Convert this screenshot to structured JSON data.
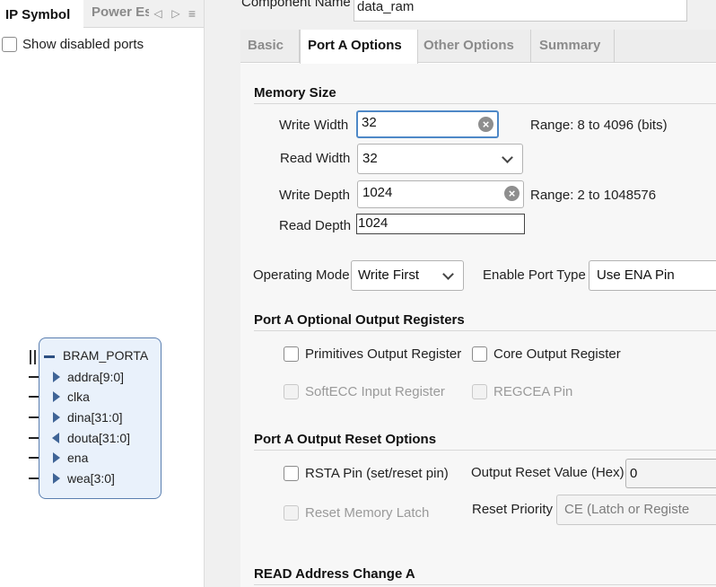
{
  "left_panel": {
    "tabs": {
      "ip_symbol": "IP Symbol",
      "power": "Power Es"
    },
    "nav": {
      "prev": "◁",
      "next": "▷",
      "menu": "≡"
    },
    "show_disabled_ports": "Show disabled ports",
    "block": {
      "bus": "BRAM_PORTA",
      "pins": [
        {
          "name": "addra[9:0]",
          "dir": "in"
        },
        {
          "name": "clka",
          "dir": "in"
        },
        {
          "name": "dina[31:0]",
          "dir": "in"
        },
        {
          "name": "douta[31:0]",
          "dir": "out"
        },
        {
          "name": "ena",
          "dir": "in"
        },
        {
          "name": "wea[3:0]",
          "dir": "in"
        }
      ]
    }
  },
  "component": {
    "label": "Component Name",
    "value": "data_ram"
  },
  "tabs": [
    "Basic",
    "Port A Options",
    "Other Options",
    "Summary"
  ],
  "active_tab": "Port A Options",
  "memory_size": {
    "title": "Memory Size",
    "write_width": {
      "label": "Write Width",
      "value": "32",
      "range": "Range: 8 to 4096 (bits)"
    },
    "read_width": {
      "label": "Read Width",
      "value": "32"
    },
    "write_depth": {
      "label": "Write Depth",
      "value": "1024",
      "range": "Range: 2 to 1048576"
    },
    "read_depth": {
      "label": "Read Depth",
      "value": "1024"
    }
  },
  "operating_mode": {
    "label": "Operating Mode",
    "value": "Write First"
  },
  "enable_port_type": {
    "label": "Enable Port Type",
    "value": "Use ENA Pin"
  },
  "optional_output_registers": {
    "title": "Port A Optional Output Registers",
    "primitives": "Primitives Output Register",
    "core": "Core Output Register",
    "softecc": "SoftECC Input Register",
    "regcea": "REGCEA Pin"
  },
  "output_reset": {
    "title": "Port A Output Reset Options",
    "rsta": "RSTA Pin (set/reset pin)",
    "reset_value_label": "Output Reset Value (Hex)",
    "reset_value": "0",
    "reset_memory_latch": "Reset Memory Latch",
    "reset_priority_label": "Reset Priority",
    "reset_priority_value": "CE (Latch or Registe"
  },
  "read_address_change": {
    "title": "READ Address Change A"
  }
}
